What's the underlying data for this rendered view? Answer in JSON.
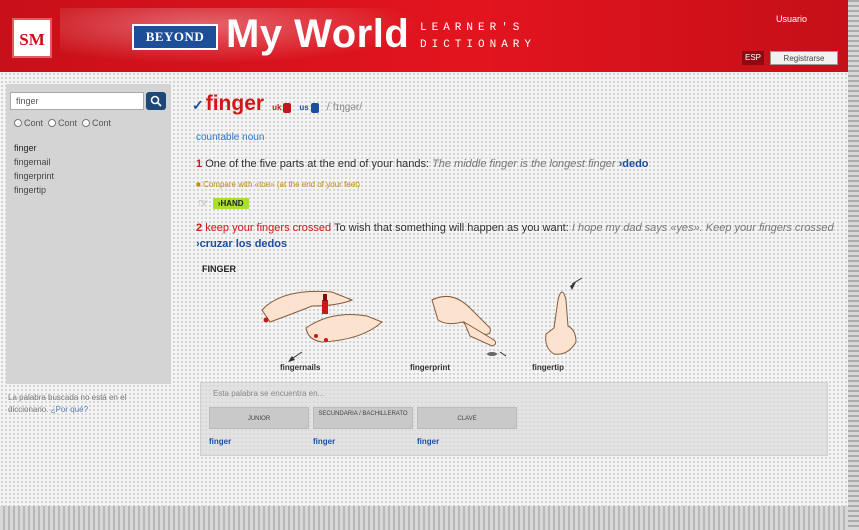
{
  "header": {
    "publisher_logo": "SM",
    "badge": "BEYOND",
    "title": "My World",
    "subtitle_line1": "LEARNER'S",
    "subtitle_line2": "DICTIONARY",
    "user_label": "Usuario",
    "lang_button": "ESP",
    "register_button": "Registrarse"
  },
  "sidebar": {
    "search_value": "finger",
    "filters": [
      "Cont",
      "Cont",
      "Cont"
    ],
    "words": [
      "finger",
      "fingernail",
      "fingerprint",
      "fingertip"
    ],
    "note_text": "La palabra buscada no está en el diccionario.",
    "note_link": "¿Por qué?"
  },
  "entry": {
    "headword": "finger",
    "uk_label": "uk",
    "us_label": "us",
    "phonetic": "/ˈfɪŋgər/",
    "pos": "countable noun",
    "sense1": {
      "num": "1",
      "definition": "One of the five parts at the end of your hands:",
      "example": "The middle finger is the longest finger",
      "translation": "dedo"
    },
    "compare": "Compare with «toe» (at the end of your feet)",
    "topic_tag": "HAND",
    "sense2": {
      "num": "2",
      "phrase": "keep your fingers crossed",
      "definition": "To wish that something will happen as you want:",
      "example": "I hope my dad says «yes». Keep your fingers crossed",
      "translation": "cruzar los dedos"
    },
    "illustration_title": "FINGER",
    "captions": [
      "fingernails",
      "fingerprint",
      "fingertip"
    ]
  },
  "more": {
    "label": "Esta palabra se encuentra en...",
    "columns": [
      "JUNIOR",
      "SECUNDARIA / BACHILLERATO",
      "CLAVE"
    ],
    "links": [
      "finger",
      "finger",
      "finger"
    ]
  }
}
